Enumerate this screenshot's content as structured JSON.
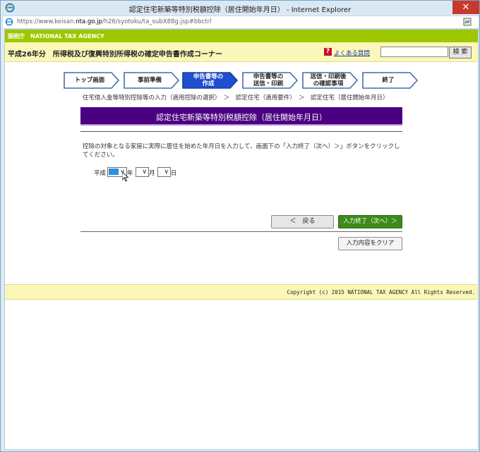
{
  "window": {
    "title": "認定住宅新築等特別税額控除（居住開始年月日） - Internet Explorer",
    "close_glyph": "✕"
  },
  "addressbar": {
    "url_prefix": "https://www.keisan.",
    "url_domain": "nta.go.jp",
    "url_path": "/h26/syotoku/ta_subX88g.jsp#bbctrl"
  },
  "header": {
    "agency": "国税庁　NATIONAL TAX AGENCY",
    "corner_title": "平成26年分　所得税及び復興特別所得税の確定申告書作成コーナー",
    "faq_icon": "?",
    "faq_link": "よくある質問",
    "search_placeholder": "",
    "search_button": "検 索"
  },
  "steps": [
    {
      "line1": "トップ画面",
      "line2": ""
    },
    {
      "line1": "事前準備",
      "line2": ""
    },
    {
      "line1": "申告書等の",
      "line2": "作成"
    },
    {
      "line1": "申告書等の",
      "line2": "送信・印刷"
    },
    {
      "line1": "送信・印刷後",
      "line2": "の確認事項"
    },
    {
      "line1": "終了",
      "line2": ""
    }
  ],
  "active_step_index": 2,
  "breadcrumb": "住宅借入金等特別控除等の入力（適用控除の選択）　＞　認定住宅（適用要件）　＞　認定住宅（居住開始年月日）",
  "section_title": "認定住宅新築等特別税額控除（居住開始年月日）",
  "instruction": "控除の対象となる家屋に実際に居住を始めた年月日を入力して、画面下の「入力終了（次へ）＞」ボタンをクリックしてください。",
  "date_form": {
    "era": "平成",
    "year_label": "年",
    "month_label": "月",
    "day_label": "日",
    "chevron": "∨"
  },
  "buttons": {
    "back": "＜　戻る",
    "next": "入力終了（次へ）＞",
    "clear": "入力内容をクリア"
  },
  "footer": {
    "copyright": "Copyright (c) 2015 NATIONAL TAX AGENCY All Rights Reserved."
  },
  "colors": {
    "agency_bar": "#9dc800",
    "section_header": "#4a0080",
    "active_step": "#1f4fd0",
    "next_button": "#3d8a19"
  }
}
